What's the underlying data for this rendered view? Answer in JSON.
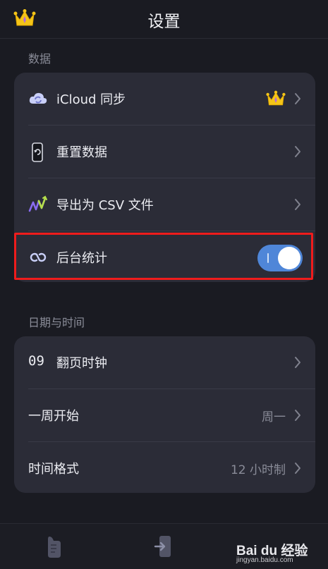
{
  "header": {
    "title": "设置",
    "crown_icon": "crown-icon"
  },
  "sections": {
    "data": {
      "label": "数据",
      "items": [
        {
          "label": "iCloud 同步",
          "icon": "cloud-sync-icon"
        },
        {
          "label": "重置数据",
          "icon": "reset-phone-icon"
        },
        {
          "label": "导出为 CSV 文件",
          "icon": "chart-export-icon"
        },
        {
          "label": "后台统计",
          "icon": "loop-icon",
          "toggle_on": true,
          "toggle_mark": "I"
        }
      ]
    },
    "datetime": {
      "label": "日期与时间",
      "items": [
        {
          "label": "翻页时钟",
          "icon_text": "09"
        },
        {
          "label": "一周开始",
          "value": "周一"
        },
        {
          "label": "时间格式",
          "value": "12 小时制"
        }
      ]
    }
  },
  "watermark": {
    "brand": "Bai du 经验",
    "url": "jingyan.baidu.com"
  },
  "colors": {
    "accent": "#4f86d8",
    "highlight": "#ef1c1c",
    "card": "#2b2c37",
    "background": "#1a1b22"
  }
}
